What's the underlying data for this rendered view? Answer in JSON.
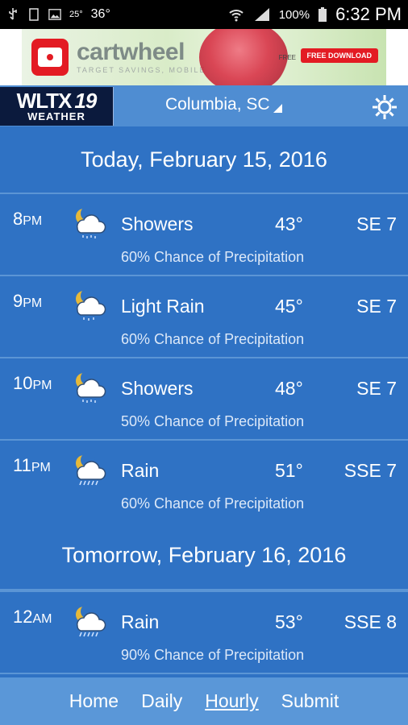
{
  "status_bar": {
    "temp": "36°",
    "small_temp": "25°",
    "battery_pct": "100%",
    "time": "6:32 PM"
  },
  "ad": {
    "brand": "cartwheel",
    "tagline": "TARGET SAVINGS, MOBILE",
    "small_text": "FREE",
    "cta": "FREE DOWNLOAD",
    "brand_color": "#e31b23"
  },
  "header": {
    "logo_line1": "WLTX",
    "logo_number": "19",
    "logo_line2": "WEATHER",
    "location": "Columbia, SC"
  },
  "days": [
    {
      "title": "Today, February 15, 2016",
      "hours": [
        {
          "time": "8",
          "ampm": "PM",
          "condition": "Showers",
          "temp": "43°",
          "wind": "SE 7",
          "precip": "60% Chance of Precipitation",
          "icon": "night-showers-icon"
        },
        {
          "time": "9",
          "ampm": "PM",
          "condition": "Light Rain",
          "temp": "45°",
          "wind": "SE 7",
          "precip": "60% Chance of Precipitation",
          "icon": "night-light-rain-icon"
        },
        {
          "time": "10",
          "ampm": "PM",
          "condition": "Showers",
          "temp": "48°",
          "wind": "SE 7",
          "precip": "50% Chance of Precipitation",
          "icon": "night-showers-icon"
        },
        {
          "time": "11",
          "ampm": "PM",
          "condition": "Rain",
          "temp": "51°",
          "wind": "SSE 7",
          "precip": "60% Chance of Precipitation",
          "icon": "night-rain-icon"
        }
      ]
    },
    {
      "title": "Tomorrow, February 16, 2016",
      "hours": [
        {
          "time": "12",
          "ampm": "AM",
          "condition": "Rain",
          "temp": "53°",
          "wind": "SSE 8",
          "precip": "90% Chance of Precipitation",
          "icon": "night-rain-icon"
        }
      ]
    }
  ],
  "nav": {
    "home": "Home",
    "daily": "Daily",
    "hourly": "Hourly",
    "submit": "Submit",
    "active": "Hourly"
  },
  "colors": {
    "background": "#2f72c4",
    "header": "#4f8dd2",
    "nav": "#5a97d8",
    "divider": "#5b95d5"
  }
}
